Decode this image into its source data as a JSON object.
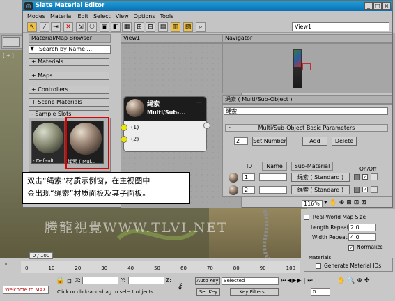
{
  "window": {
    "title": "Slate Material Editor"
  },
  "menu": [
    "Modes",
    "Material",
    "Edit",
    "Select",
    "View",
    "Options",
    "Tools"
  ],
  "toolbar": {
    "view_combo": "View1"
  },
  "browser": {
    "title": "Material/Map Browser",
    "search_placeholder": "Search by Name ...",
    "rollouts": [
      "+ Materials",
      "+ Maps",
      "+ Controllers",
      "+ Scene Materials",
      "- Sample Slots"
    ],
    "slots": [
      "- Default ...",
      "绳索 ( Mul..."
    ]
  },
  "view": {
    "tab": "View1"
  },
  "node": {
    "name": "绳索",
    "type": "Multi/Sub-...",
    "ports": [
      "(1)",
      "(2)"
    ]
  },
  "navigator": {
    "title": "Navigator"
  },
  "params": {
    "header": "绳索 ( Multi/Sub-Object )",
    "name_field": "绳索",
    "rollout": "Multi/Sub-Object Basic Parameters",
    "set_number_value": "2",
    "set_number_btn": "Set Number",
    "add_btn": "Add",
    "delete_btn": "Delete",
    "col_id": "ID",
    "col_name": "Name",
    "col_sub": "Sub-Material",
    "col_onoff": "On/Off",
    "rows": [
      {
        "id": "1",
        "sub": "绳索 ( Standard )"
      },
      {
        "id": "2",
        "sub": "绳索 ( Standard )"
      }
    ],
    "zoom": "116%"
  },
  "caption": {
    "line1": "双击“绳索”材质示例窗，在主视图中",
    "line2": "会出现“绳索”材质面板及其子面板。"
  },
  "right_panel": {
    "realworld": "Real-World Map Size",
    "length_label": "Length Repeat:",
    "length_value": "2.0",
    "width_label": "Width Repeat:",
    "width_value": "4.0",
    "normalize": "Normalize",
    "materials_group": "Materials",
    "generate_ids": "Generate Material IDs"
  },
  "timeline": {
    "frame": "0 / 100",
    "ticks": [
      "0",
      "10",
      "20",
      "30",
      "40",
      "50",
      "60",
      "70",
      "80",
      "90",
      "100"
    ]
  },
  "status": {
    "welcome": "Welcome to MAX",
    "prompt": "Click or click-and-drag to select objects",
    "x_label": "X:",
    "y_label": "Y:",
    "z_label": "Z:",
    "autokey": "Auto Key",
    "selected": "Selected",
    "setkey": "Set Key",
    "keyfilters": "Key Filters...",
    "frame_value": "0"
  },
  "watermark": "腾龍視覺WWW.TLVI.NET"
}
